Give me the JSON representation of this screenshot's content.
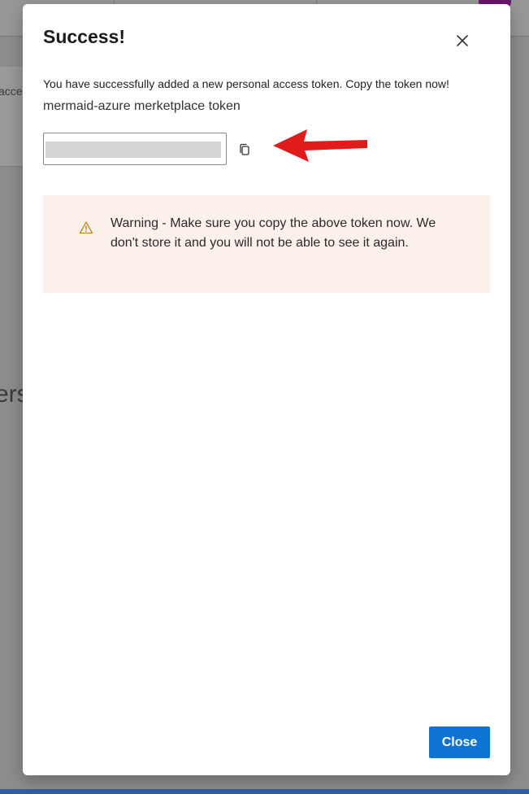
{
  "background": {
    "partial_text_left": "acce",
    "partial_heading_left": "ers"
  },
  "dialog": {
    "title": "Success!",
    "message": "You have successfully added a new personal access token. Copy the token now!",
    "token_name": "mermaid-azure merketplace token",
    "token_value": "",
    "warning_text": "Warning - Make sure you copy the above token now. We don't store it and you will not be able to see it again.",
    "close_button_label": "Close",
    "icons": {
      "close": "close-icon",
      "copy": "copy-icon",
      "warning": "warning-icon"
    },
    "colors": {
      "primary_button": "#0f73d4",
      "warning_background": "#fcf0eb",
      "warning_icon": "#c28a1a",
      "annotation_arrow": "#e01b1b",
      "token_mask": "#d3d4d6"
    }
  }
}
